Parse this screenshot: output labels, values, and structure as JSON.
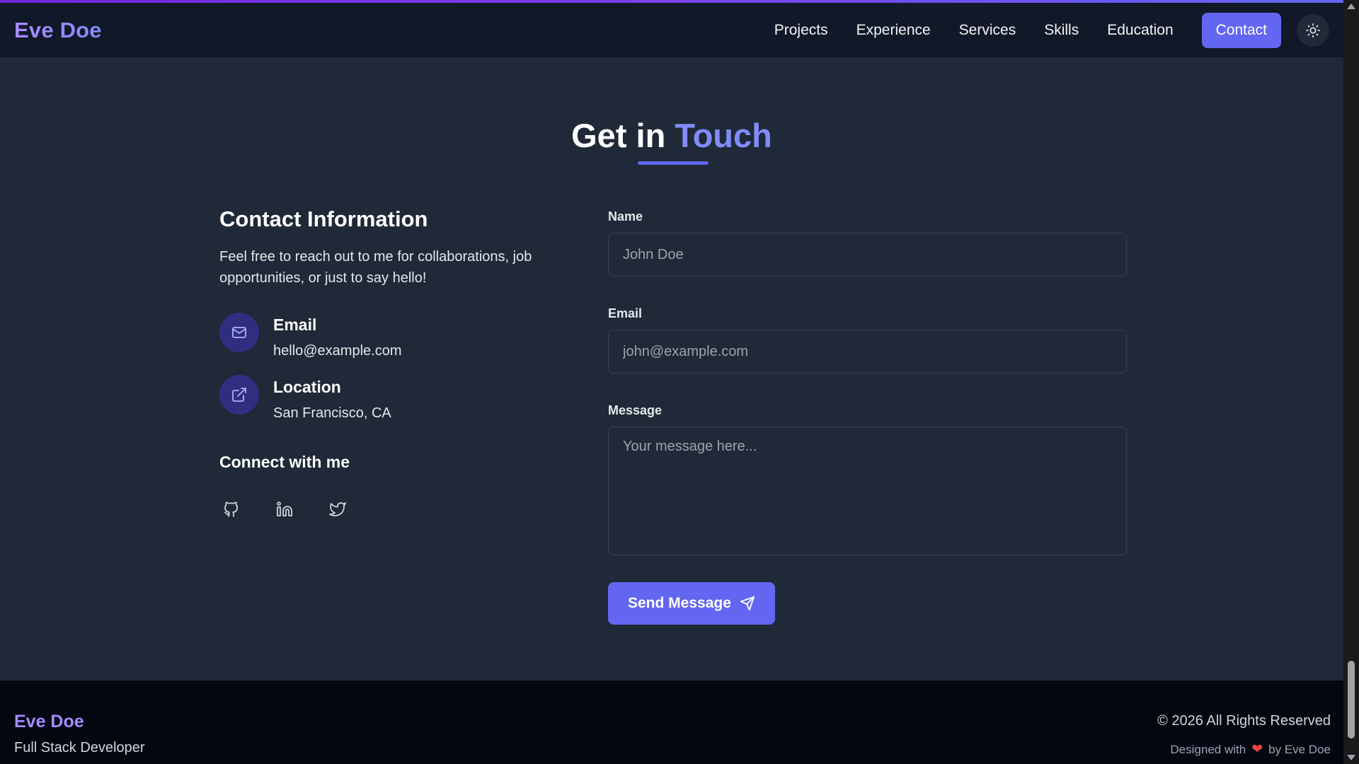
{
  "header": {
    "logo": "Eve Doe",
    "nav": [
      "Projects",
      "Experience",
      "Services",
      "Skills",
      "Education"
    ],
    "contact_label": "Contact",
    "theme_icon": "sun-icon"
  },
  "section": {
    "title_main": "Get in",
    "title_accent": "Touch"
  },
  "contact_info": {
    "heading": "Contact Information",
    "intro": "Feel free to reach out to me for collaborations, job opportunities, or just to say hello!",
    "items": [
      {
        "label": "Email",
        "value": "hello@example.com",
        "icon": "mail-icon"
      },
      {
        "label": "Location",
        "value": "San Francisco, CA",
        "icon": "external-link-icon"
      }
    ],
    "connect_heading": "Connect with me",
    "socials": [
      "github-icon",
      "linkedin-icon",
      "twitter-icon"
    ]
  },
  "form": {
    "name_label": "Name",
    "name_placeholder": "John Doe",
    "email_label": "Email",
    "email_placeholder": "john@example.com",
    "message_label": "Message",
    "message_placeholder": "Your message here...",
    "send_label": "Send Message"
  },
  "footer": {
    "name": "Eve Doe",
    "role": "Full Stack Developer",
    "copyright": "© 2026 All Rights Reserved",
    "designed_prefix": "Designed with",
    "designed_suffix": "by Eve Doe"
  },
  "colors": {
    "accent": "#6366f1",
    "logo": "#a78bfa",
    "background": "#1f2937",
    "header": "#111827",
    "footer": "#030712"
  }
}
